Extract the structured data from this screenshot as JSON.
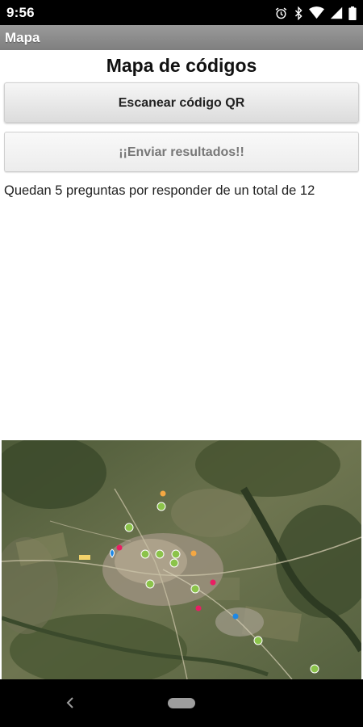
{
  "status_bar": {
    "time": "9:56",
    "icons": [
      "alarm-icon",
      "bluetooth-icon",
      "wifi-icon",
      "signal-icon",
      "battery-icon"
    ]
  },
  "app_bar": {
    "title": "Mapa"
  },
  "main": {
    "title": "Mapa de códigos",
    "scan_button_label": "Escanear código QR",
    "send_button_label": "¡¡Enviar resultados!!",
    "progress_text": "Quedan 5 preguntas por responder de un total de 12"
  },
  "map": {
    "type": "satellite",
    "markers": [
      "place-marker",
      "location-pin-icon",
      "info-marker"
    ]
  },
  "nav_bar": {
    "buttons": [
      "back-button",
      "home-button"
    ]
  },
  "colors": {
    "app_bar": "#8c8c8c",
    "button_bg": "#e6e6e6",
    "marker_green": "#8bc34a",
    "marker_blue": "#1e88e5",
    "marker_pink": "#e91e63"
  }
}
